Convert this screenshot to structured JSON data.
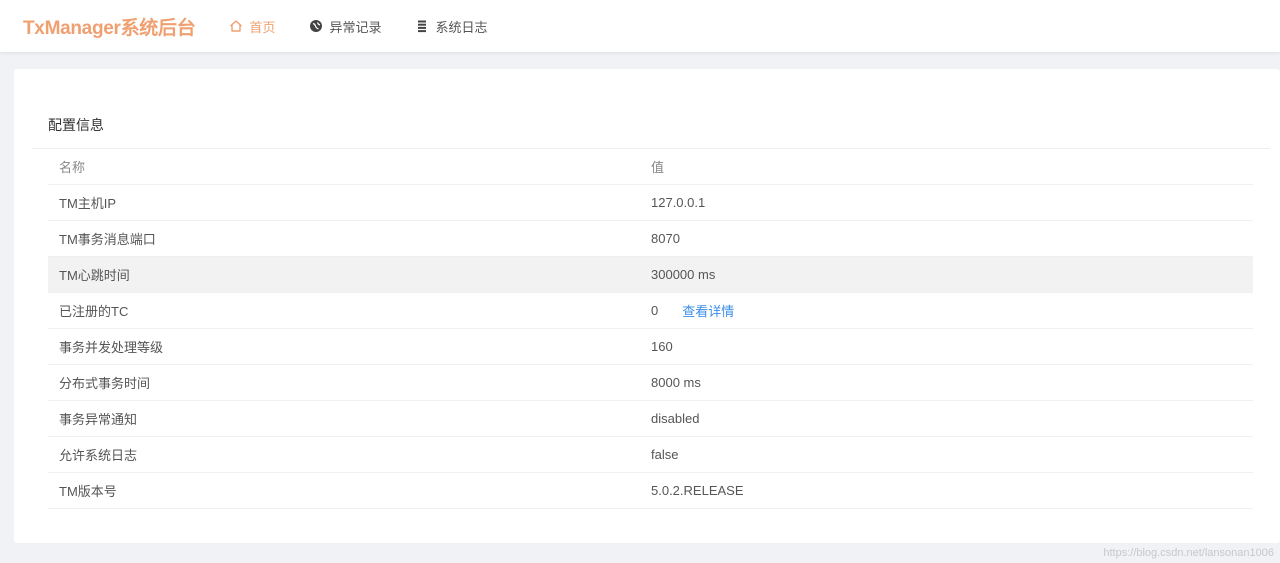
{
  "header": {
    "brand": "TxManager系统后台",
    "nav": [
      {
        "label": "首页",
        "icon": "home-icon",
        "active": true
      },
      {
        "label": "异常记录",
        "icon": "globe-icon",
        "active": false
      },
      {
        "label": "系统日志",
        "icon": "list-icon",
        "active": false
      }
    ]
  },
  "colors": {
    "accent": "#f0a070",
    "link": "#3a8ee6"
  },
  "config": {
    "title": "配置信息",
    "columns": {
      "name": "名称",
      "value": "值"
    },
    "rows": [
      {
        "name": "TM主机IP",
        "value": "127.0.0.1"
      },
      {
        "name": "TM事务消息端口",
        "value": "8070"
      },
      {
        "name": "TM心跳时间",
        "value": "300000 ms"
      },
      {
        "name": "已注册的TC",
        "value": "0",
        "link": "查看详情"
      },
      {
        "name": "事务并发处理等级",
        "value": "160"
      },
      {
        "name": "分布式事务时间",
        "value": "8000 ms"
      },
      {
        "name": "事务异常通知",
        "value": "disabled"
      },
      {
        "name": "允许系统日志",
        "value": "false"
      },
      {
        "name": "TM版本号",
        "value": "5.0.2.RELEASE"
      }
    ]
  },
  "watermark": "https://blog.csdn.net/lansonan1006"
}
